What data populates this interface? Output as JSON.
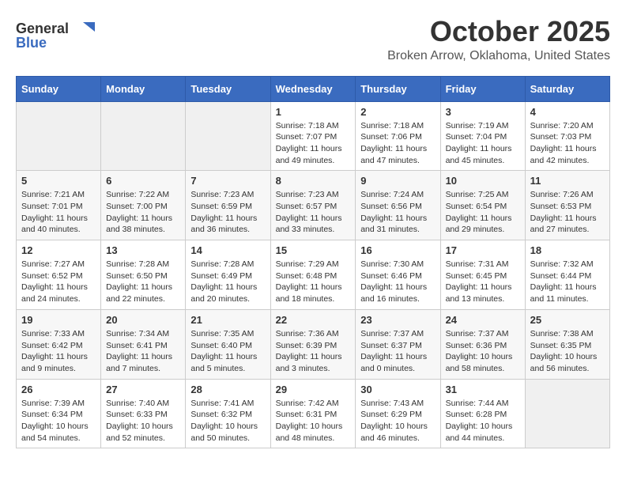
{
  "header": {
    "logo_general": "General",
    "logo_blue": "Blue",
    "month_title": "October 2025",
    "location": "Broken Arrow, Oklahoma, United States"
  },
  "days_of_week": [
    "Sunday",
    "Monday",
    "Tuesday",
    "Wednesday",
    "Thursday",
    "Friday",
    "Saturday"
  ],
  "weeks": [
    [
      {
        "day": "",
        "info": ""
      },
      {
        "day": "",
        "info": ""
      },
      {
        "day": "",
        "info": ""
      },
      {
        "day": "1",
        "info": "Sunrise: 7:18 AM\nSunset: 7:07 PM\nDaylight: 11 hours\nand 49 minutes."
      },
      {
        "day": "2",
        "info": "Sunrise: 7:18 AM\nSunset: 7:06 PM\nDaylight: 11 hours\nand 47 minutes."
      },
      {
        "day": "3",
        "info": "Sunrise: 7:19 AM\nSunset: 7:04 PM\nDaylight: 11 hours\nand 45 minutes."
      },
      {
        "day": "4",
        "info": "Sunrise: 7:20 AM\nSunset: 7:03 PM\nDaylight: 11 hours\nand 42 minutes."
      }
    ],
    [
      {
        "day": "5",
        "info": "Sunrise: 7:21 AM\nSunset: 7:01 PM\nDaylight: 11 hours\nand 40 minutes."
      },
      {
        "day": "6",
        "info": "Sunrise: 7:22 AM\nSunset: 7:00 PM\nDaylight: 11 hours\nand 38 minutes."
      },
      {
        "day": "7",
        "info": "Sunrise: 7:23 AM\nSunset: 6:59 PM\nDaylight: 11 hours\nand 36 minutes."
      },
      {
        "day": "8",
        "info": "Sunrise: 7:23 AM\nSunset: 6:57 PM\nDaylight: 11 hours\nand 33 minutes."
      },
      {
        "day": "9",
        "info": "Sunrise: 7:24 AM\nSunset: 6:56 PM\nDaylight: 11 hours\nand 31 minutes."
      },
      {
        "day": "10",
        "info": "Sunrise: 7:25 AM\nSunset: 6:54 PM\nDaylight: 11 hours\nand 29 minutes."
      },
      {
        "day": "11",
        "info": "Sunrise: 7:26 AM\nSunset: 6:53 PM\nDaylight: 11 hours\nand 27 minutes."
      }
    ],
    [
      {
        "day": "12",
        "info": "Sunrise: 7:27 AM\nSunset: 6:52 PM\nDaylight: 11 hours\nand 24 minutes."
      },
      {
        "day": "13",
        "info": "Sunrise: 7:28 AM\nSunset: 6:50 PM\nDaylight: 11 hours\nand 22 minutes."
      },
      {
        "day": "14",
        "info": "Sunrise: 7:28 AM\nSunset: 6:49 PM\nDaylight: 11 hours\nand 20 minutes."
      },
      {
        "day": "15",
        "info": "Sunrise: 7:29 AM\nSunset: 6:48 PM\nDaylight: 11 hours\nand 18 minutes."
      },
      {
        "day": "16",
        "info": "Sunrise: 7:30 AM\nSunset: 6:46 PM\nDaylight: 11 hours\nand 16 minutes."
      },
      {
        "day": "17",
        "info": "Sunrise: 7:31 AM\nSunset: 6:45 PM\nDaylight: 11 hours\nand 13 minutes."
      },
      {
        "day": "18",
        "info": "Sunrise: 7:32 AM\nSunset: 6:44 PM\nDaylight: 11 hours\nand 11 minutes."
      }
    ],
    [
      {
        "day": "19",
        "info": "Sunrise: 7:33 AM\nSunset: 6:42 PM\nDaylight: 11 hours\nand 9 minutes."
      },
      {
        "day": "20",
        "info": "Sunrise: 7:34 AM\nSunset: 6:41 PM\nDaylight: 11 hours\nand 7 minutes."
      },
      {
        "day": "21",
        "info": "Sunrise: 7:35 AM\nSunset: 6:40 PM\nDaylight: 11 hours\nand 5 minutes."
      },
      {
        "day": "22",
        "info": "Sunrise: 7:36 AM\nSunset: 6:39 PM\nDaylight: 11 hours\nand 3 minutes."
      },
      {
        "day": "23",
        "info": "Sunrise: 7:37 AM\nSunset: 6:37 PM\nDaylight: 11 hours\nand 0 minutes."
      },
      {
        "day": "24",
        "info": "Sunrise: 7:37 AM\nSunset: 6:36 PM\nDaylight: 10 hours\nand 58 minutes."
      },
      {
        "day": "25",
        "info": "Sunrise: 7:38 AM\nSunset: 6:35 PM\nDaylight: 10 hours\nand 56 minutes."
      }
    ],
    [
      {
        "day": "26",
        "info": "Sunrise: 7:39 AM\nSunset: 6:34 PM\nDaylight: 10 hours\nand 54 minutes."
      },
      {
        "day": "27",
        "info": "Sunrise: 7:40 AM\nSunset: 6:33 PM\nDaylight: 10 hours\nand 52 minutes."
      },
      {
        "day": "28",
        "info": "Sunrise: 7:41 AM\nSunset: 6:32 PM\nDaylight: 10 hours\nand 50 minutes."
      },
      {
        "day": "29",
        "info": "Sunrise: 7:42 AM\nSunset: 6:31 PM\nDaylight: 10 hours\nand 48 minutes."
      },
      {
        "day": "30",
        "info": "Sunrise: 7:43 AM\nSunset: 6:29 PM\nDaylight: 10 hours\nand 46 minutes."
      },
      {
        "day": "31",
        "info": "Sunrise: 7:44 AM\nSunset: 6:28 PM\nDaylight: 10 hours\nand 44 minutes."
      },
      {
        "day": "",
        "info": ""
      }
    ]
  ]
}
